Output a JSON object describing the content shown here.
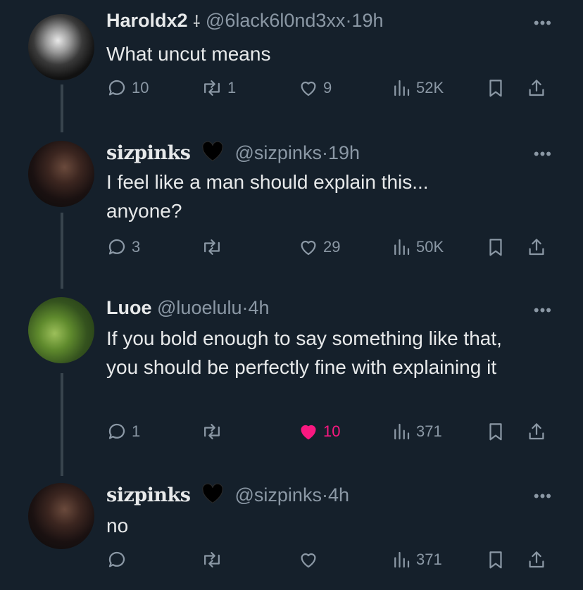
{
  "tweets": [
    {
      "name": "Haroldx2",
      "badge": "⸸",
      "handle": "@6lack6l0nd3xx",
      "dot": "·",
      "time": "19h",
      "text": "What uncut means",
      "replies": "10",
      "retweets": "1",
      "likes": "9",
      "views": "52K"
    },
    {
      "name": "sizpinks",
      "handle": "@sizpinks",
      "dot": "·",
      "time": "19h",
      "text": "I feel like a man should explain this... anyone?",
      "replies": "3",
      "retweets": "",
      "likes": "29",
      "views": "50K"
    },
    {
      "name": "Luoe",
      "handle": "@luoelulu",
      "dot": "·",
      "time": "4h",
      "text": "If you bold enough to say something like that, you should be perfectly fine with explaining it",
      "replies": "1",
      "retweets": "",
      "likes": "10",
      "views": "371"
    },
    {
      "name": "sizpinks",
      "handle": "@sizpinks",
      "dot": "·",
      "time": "4h",
      "text": "no",
      "replies": "",
      "retweets": "",
      "likes": "",
      "views": "371"
    }
  ],
  "more_label": "•••",
  "colors": {
    "background": "#15202b",
    "muted": "#8b98a5",
    "like_active": "#f91880",
    "thread_line": "#38444d"
  },
  "icons": [
    "reply-icon",
    "retweet-icon",
    "heart-icon",
    "views-icon",
    "bookmark-icon",
    "share-icon",
    "black-heart-icon",
    "more-icon"
  ]
}
